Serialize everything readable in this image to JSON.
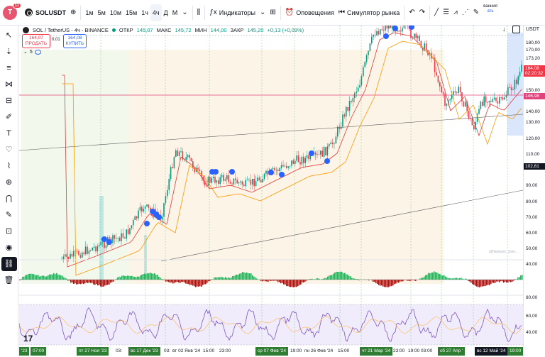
{
  "topbar": {
    "avatar_letter": "T",
    "avatar_badge": "11",
    "symbol": "SOLUSDT",
    "add_symbol_icon": "plus-circle-icon",
    "timeframes": [
      "1м",
      "5м",
      "10м",
      "15м",
      "1ч",
      "4ч",
      "Д",
      "М"
    ],
    "active_timeframe": "4ч",
    "indicators_label": "Индикаторы",
    "alerts_label": "Оповещения",
    "replay_label": "Симулятор рынка",
    "right_label_top": "ванния",
    "right_label_bottom": "ать"
  },
  "legend": {
    "title": "SOL / TetherUS - 4ч - BINANCE",
    "open_label": "ОТКР",
    "open": "145,07",
    "high_label": "МАКС",
    "high": "145,72",
    "low_label": "МИН",
    "low": "144,00",
    "close_label": "ЗАКР",
    "close": "145,20",
    "change": "+0,13 (+0,09%)",
    "sell_price": "164,07",
    "sell_label": "ПРОДАТЬ",
    "spread": "0,01",
    "buy_price": "164,08",
    "buy_label": "КУПИТЬ",
    "study_count": "5"
  },
  "price_axis": {
    "currency": "USDT",
    "ticks": [
      "180,00",
      "170,00",
      "160,00",
      "150,00",
      "140,00",
      "130,00",
      "120,00",
      "110,00",
      "100,00",
      "90,00",
      "80,00",
      "70,00",
      "60,00",
      "50,00",
      "40,00"
    ],
    "tag_upper": "173,20",
    "tag_current_price": "164,08",
    "tag_current_timer": "02:20:32",
    "tag_line": "146,98",
    "tag_cursor": "102,61",
    "osc_ticks": [
      "80,00",
      "60,00",
      "40,00"
    ]
  },
  "time_axis": {
    "labels": [
      "'23",
      "07:00",
      "пт 27 Ноя '23",
      "03:",
      "вс 17 Дек '23",
      "03:",
      "вт 02 Янв '24",
      "15:00",
      "23:00",
      "ср 07 Фев '24",
      "19:00",
      "пн 26 Фев '24",
      "15:00",
      "чт 21 Мар '24",
      "23:00",
      "19:00",
      "03:00",
      "сб 27 Апр '",
      "вс 12 Май '24",
      "19:00"
    ]
  },
  "watermark": "@Neptune_Sam...",
  "colors": {
    "up": "#089981",
    "down": "#f23645",
    "accent": "#2962ff",
    "highlight_green": "#2e7d32",
    "price_tag": "#f23645",
    "line_tag": "#e0447a"
  },
  "icons": {
    "left_toolbar": [
      "cursor-icon",
      "crosshair-dot-icon",
      "trend-lines-icon",
      "pattern-icon",
      "fib-icon",
      "brush-icon",
      "text-icon",
      "heart-icon",
      "ruler-icon",
      "zoom-icon",
      "magnet-icon",
      "pencil-lock-icon",
      "lock-icon",
      "eye-icon",
      "link-icon",
      "trash-icon"
    ]
  }
}
